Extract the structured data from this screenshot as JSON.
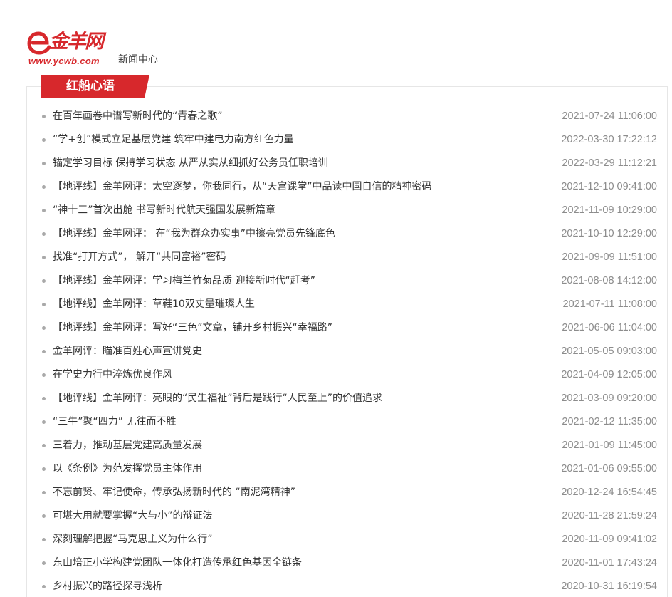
{
  "header": {
    "logo_wordmark": "金羊网",
    "logo_domain": "www.ycwb.com",
    "section": "新闻中心"
  },
  "panel": {
    "tab_label": "红船心语"
  },
  "news": [
    {
      "title": "在百年画卷中谱写新时代的“青春之歌”",
      "date": "2021-07-24 11:06:00"
    },
    {
      "title": "“学+创”模式立足基层党建 筑牢中建电力南方红色力量",
      "date": "2022-03-30 17:22:12"
    },
    {
      "title": "锚定学习目标 保持学习状态 从严从实从细抓好公务员任职培训",
      "date": "2022-03-29 11:12:21"
    },
    {
      "title": "【地评线】金羊网评：太空逐梦，你我同行，从“天宫课堂”中品读中国自信的精神密码",
      "date": "2021-12-10 09:41:00"
    },
    {
      "title": "“神十三”首次出舱 书写新时代航天强国发展新篇章",
      "date": "2021-11-09 10:29:00"
    },
    {
      "title": "【地评线】金羊网评： 在“我为群众办实事”中擦亮党员先锋底色",
      "date": "2021-10-10 12:29:00"
    },
    {
      "title": "找准“打开方式”， 解开“共同富裕”密码",
      "date": "2021-09-09 11:51:00"
    },
    {
      "title": "【地评线】金羊网评：学习梅兰竹菊品质 迎接新时代“赶考”",
      "date": "2021-08-08 14:12:00"
    },
    {
      "title": "【地评线】金羊网评：草鞋10双丈量璀璨人生",
      "date": "2021-07-11 11:08:00"
    },
    {
      "title": "【地评线】金羊网评：写好“三色”文章，铺开乡村振兴“幸福路”",
      "date": "2021-06-06 11:04:00"
    },
    {
      "title": "金羊网评：瞄准百姓心声宣讲党史",
      "date": "2021-05-05 09:03:00"
    },
    {
      "title": "在学史力行中淬炼优良作风",
      "date": "2021-04-09 12:05:00"
    },
    {
      "title": "【地评线】金羊网评：亮眼的“民生福祉”背后是践行“人民至上”的价值追求",
      "date": "2021-03-09 09:20:00"
    },
    {
      "title": "“三牛”聚“四力” 无往而不胜",
      "date": "2021-02-12 11:35:00"
    },
    {
      "title": "三着力，推动基层党建高质量发展",
      "date": "2021-01-09 11:45:00"
    },
    {
      "title": "以《条例》为范发挥党员主体作用",
      "date": "2021-01-06 09:55:00"
    },
    {
      "title": "不忘前贤、牢记使命，传承弘扬新时代的 “南泥湾精神”",
      "date": "2020-12-24 16:54:45"
    },
    {
      "title": "可堪大用就要掌握“大与小”的辩证法",
      "date": "2020-11-28 21:59:24"
    },
    {
      "title": "深刻理解把握“马克思主义为什么行”",
      "date": "2020-11-09 09:41:02"
    },
    {
      "title": "东山培正小学构建党团队一体化打造传承红色基因全链条",
      "date": "2020-11-01 17:43:24"
    },
    {
      "title": "乡村振兴的路径探寻浅析",
      "date": "2020-10-31 16:19:54"
    }
  ],
  "colors": {
    "brand_red": "#d7282c",
    "title_text": "#333333",
    "date_text": "#8c8c8c",
    "bullet": "#a9a9a9",
    "panel_border": "#e6e6e6"
  }
}
